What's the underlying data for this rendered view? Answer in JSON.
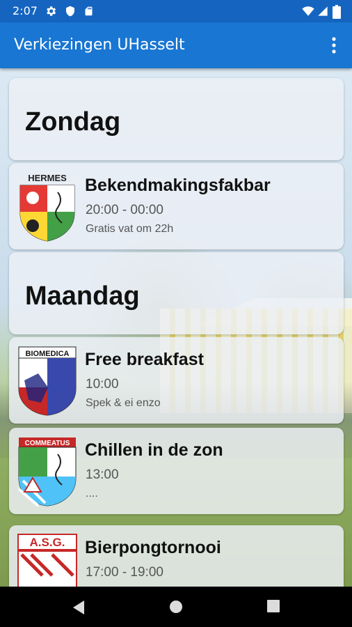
{
  "status_bar": {
    "time": "2:07",
    "left_icons": [
      "gear-icon",
      "shield-icon",
      "sd-card-icon"
    ],
    "right_icons": [
      "wifi-icon",
      "signal-icon",
      "battery-icon"
    ]
  },
  "app_bar": {
    "title": "Verkiezingen UHasselt",
    "menu_icon": "more-vert-icon",
    "color": "#1976d2"
  },
  "days": [
    {
      "label": "Zondag"
    },
    {
      "label": "Maandag"
    }
  ],
  "events": [
    {
      "logo_text": "HERMES",
      "title": "Bekendmakingsfakbar",
      "time": "20:00 - 00:00",
      "description": "Gratis vat om 22h"
    },
    {
      "logo_text": "BIOMEDICA",
      "title": "Free breakfast",
      "time": "10:00",
      "description": "Spek & ei enzo"
    },
    {
      "logo_text": "COMMEATUS",
      "title": "Chillen in de zon",
      "time": "13:00",
      "description": "...."
    },
    {
      "logo_text": "A.S.G.",
      "title": "Bierpongtornooi",
      "time": "17:00 - 19:00",
      "description": ""
    }
  ],
  "nav_bar": {
    "icons": [
      "back-icon",
      "home-icon",
      "recents-icon"
    ]
  }
}
